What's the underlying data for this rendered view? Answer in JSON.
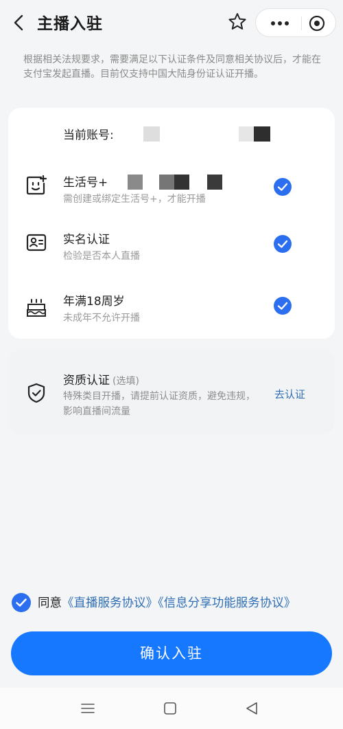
{
  "header": {
    "title": "主播入驻",
    "icons": [
      "back-chevron",
      "star-outline",
      "more-dots",
      "close-circle"
    ]
  },
  "notice": "根据相关法规要求，需要满足以下认证条件及同意相关协议后，才能在支付宝发起直播。目前仅支持中国大陆身份证认证开播。",
  "account": {
    "label": "当前账号:"
  },
  "requirements": [
    {
      "title": "生活号+",
      "desc": "需创建或绑定生活号+，才能开播",
      "icon": "lifestyle-account-icon",
      "checked": true
    },
    {
      "title": "实名认证",
      "desc": "检验是否本人直播",
      "icon": "id-card-icon",
      "checked": true
    },
    {
      "title": "年满18周岁",
      "desc": "未成年不允许开播",
      "icon": "birthday-cake-icon",
      "checked": true
    }
  ],
  "qualification": {
    "title": "资质认证",
    "optional": "(选填)",
    "desc": "特殊类目开播，请提前认证资质，避免违规，影响直播间流量",
    "action": "去认证"
  },
  "agreement": {
    "prefix": "同意",
    "link1": "《直播服务协议》",
    "link2": "《信息分享功能服务协议》",
    "checked": true
  },
  "confirm_button": "确认入驻",
  "colors": {
    "accent": "#1677ff",
    "check": "#2b6ef0",
    "link": "#2f6eb5"
  }
}
